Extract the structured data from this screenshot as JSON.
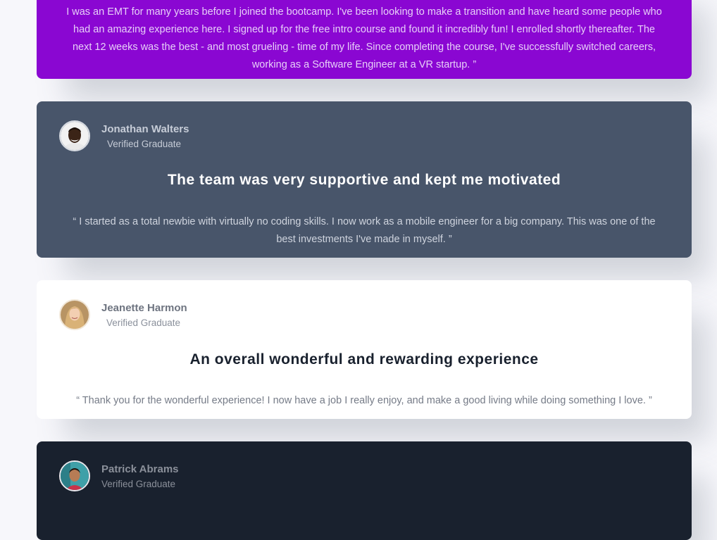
{
  "testimonials": [
    {
      "quote": "I was an EMT for many years before I joined the bootcamp. I've been looking to make a transition and have heard some people who had an amazing experience here. I signed up for the free intro course and found it incredibly fun! I enrolled shortly thereafter. The next 12 weeks was the best - and most grueling - time of my life. Since completing the course, I've successfully switched careers, working as a Software Engineer at a VR startup. ”"
    },
    {
      "name": "Jonathan Walters",
      "role": "Verified Graduate",
      "headline": "The team was very supportive and kept me motivated",
      "quote": "“ I started as a total newbie with virtually no coding skills. I now work as a mobile engineer for a big company. This was one of the best investments I've made in myself. ”"
    },
    {
      "name": "Jeanette Harmon",
      "role": "Verified Graduate",
      "headline": "An overall wonderful and rewarding experience",
      "quote": "“ Thank you for the wonderful experience! I now have a job I really enjoy, and make a good living while doing something I love. ”"
    },
    {
      "name": "Patrick Abrams",
      "role": "Verified Graduate"
    }
  ],
  "colors": {
    "purple": "#8a07d2",
    "slate": "#48556a",
    "white": "#ffffff",
    "dark": "#19212e"
  },
  "icons": [
    "avatar-jonathan",
    "avatar-jeanette",
    "avatar-patrick"
  ]
}
